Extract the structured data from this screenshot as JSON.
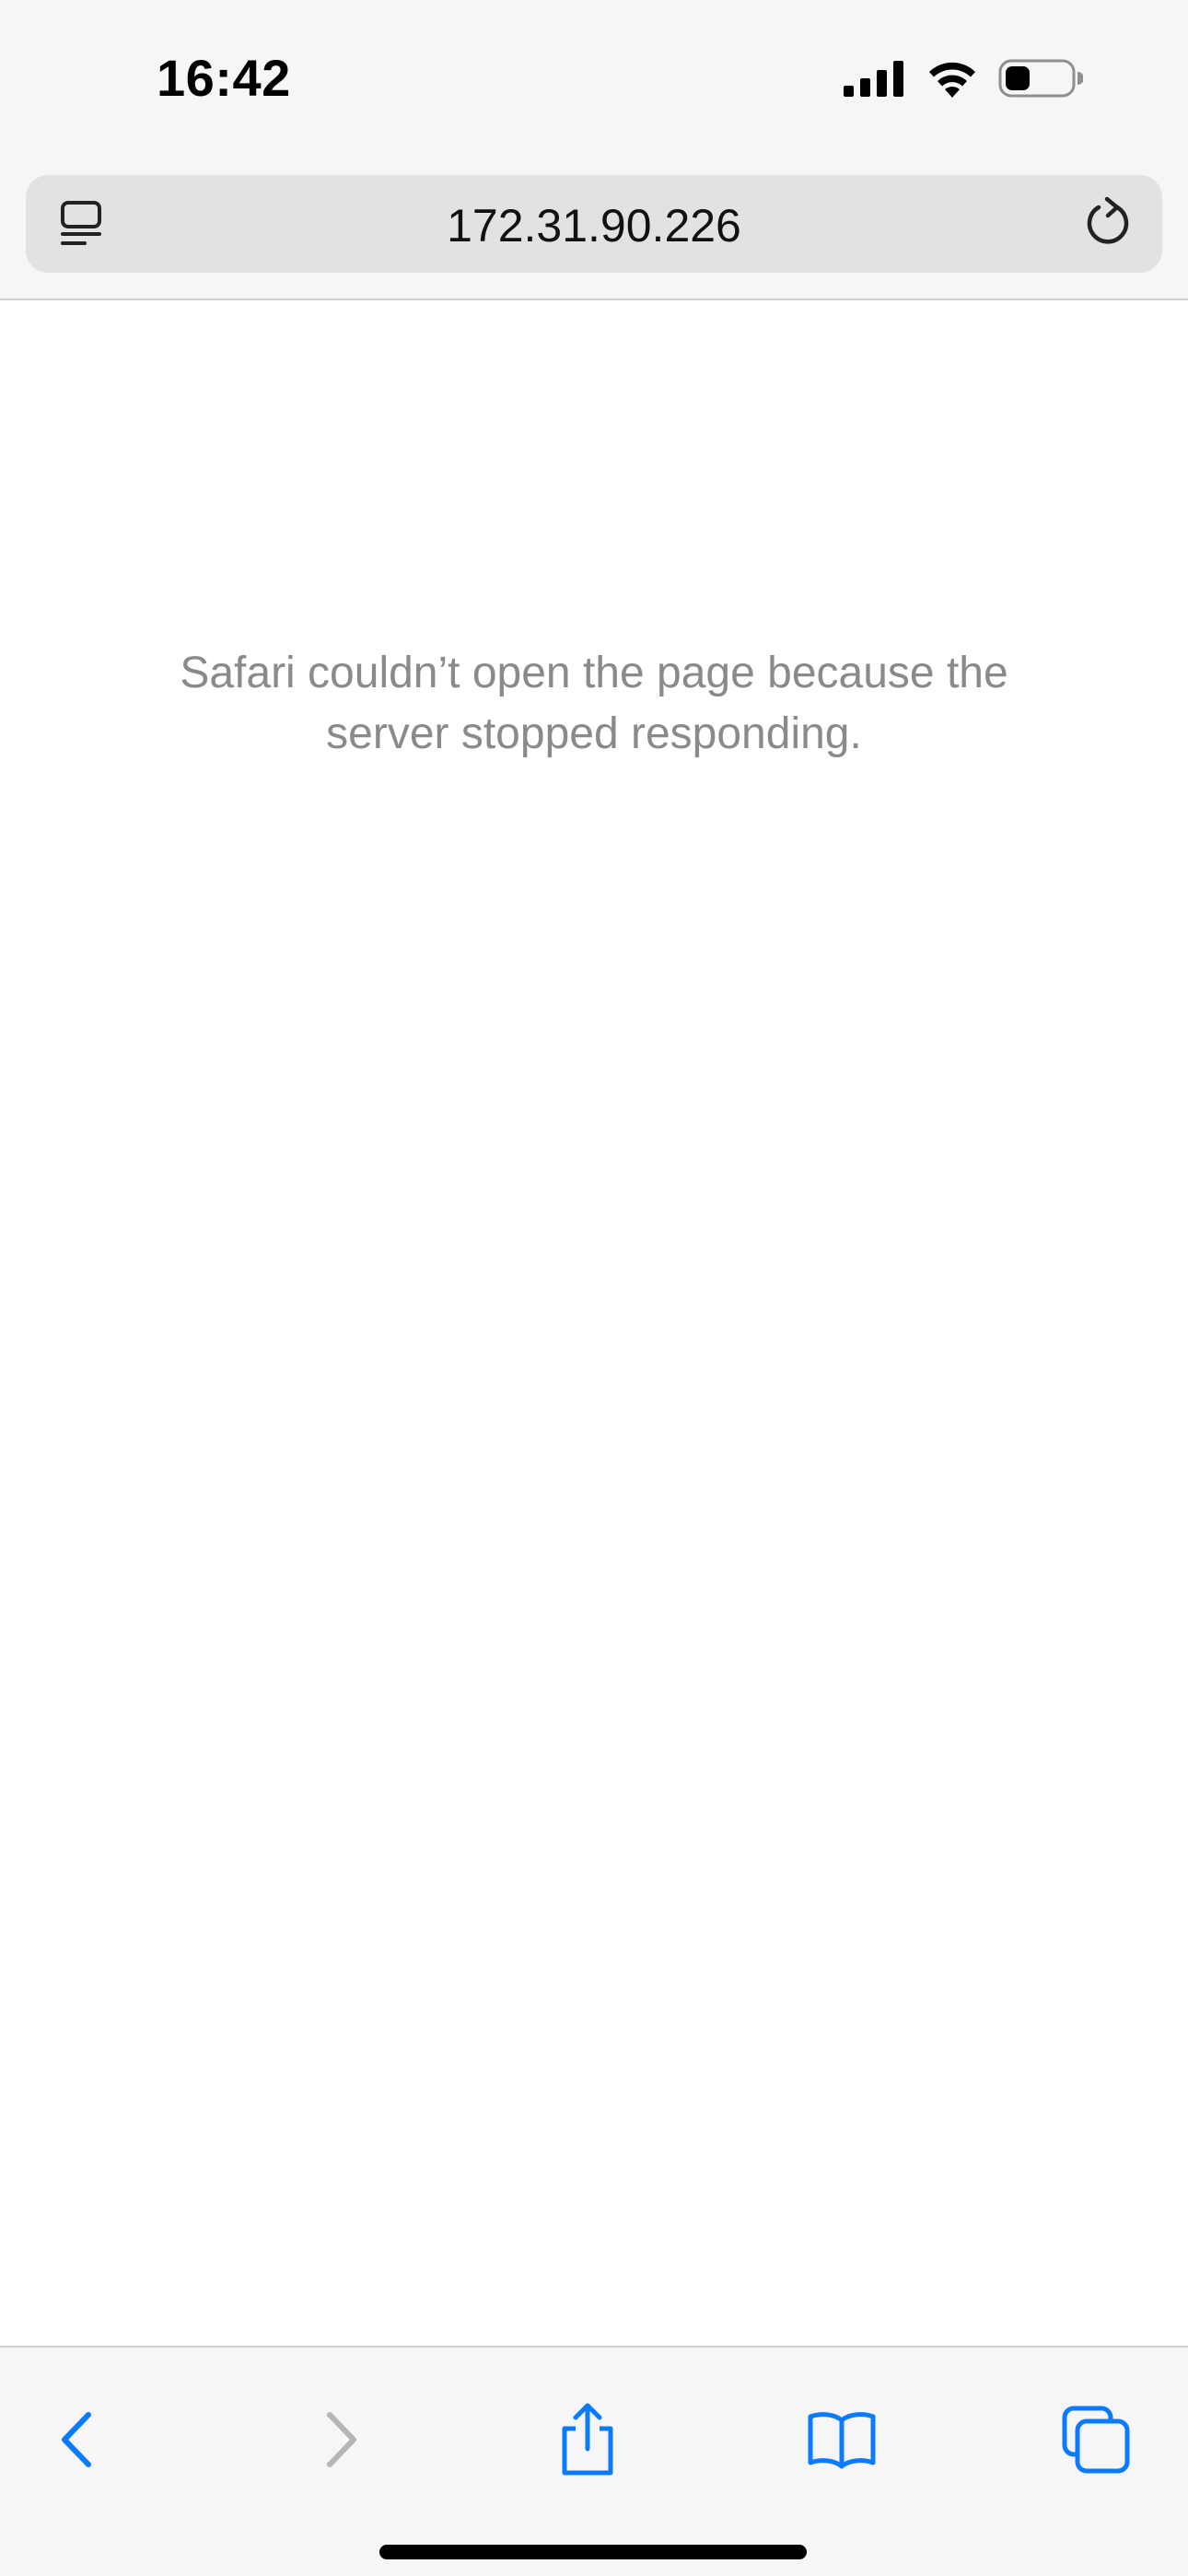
{
  "status_bar": {
    "time": "16:42",
    "icons": [
      "cellular-signal-icon",
      "wifi-icon",
      "battery-icon"
    ]
  },
  "address_bar": {
    "url": "172.31.90.226",
    "left_icon": "reader-page-menu-icon",
    "right_icon": "reload-icon"
  },
  "page": {
    "error_message": "Safari couldn’t open the page because the server stopped responding."
  },
  "toolbar": {
    "items": [
      {
        "icon": "back-chevron-icon",
        "enabled": true
      },
      {
        "icon": "forward-chevron-icon",
        "enabled": false
      },
      {
        "icon": "share-icon",
        "enabled": true
      },
      {
        "icon": "bookmarks-book-icon",
        "enabled": true
      },
      {
        "icon": "tabs-icon",
        "enabled": true
      }
    ]
  },
  "colors": {
    "accent": "#0a7aff",
    "disabled": "#b5b5b9",
    "chrome_bg": "#f6f6f6",
    "address_bg": "#e2e2e3",
    "message_text": "#8a8a8e"
  }
}
